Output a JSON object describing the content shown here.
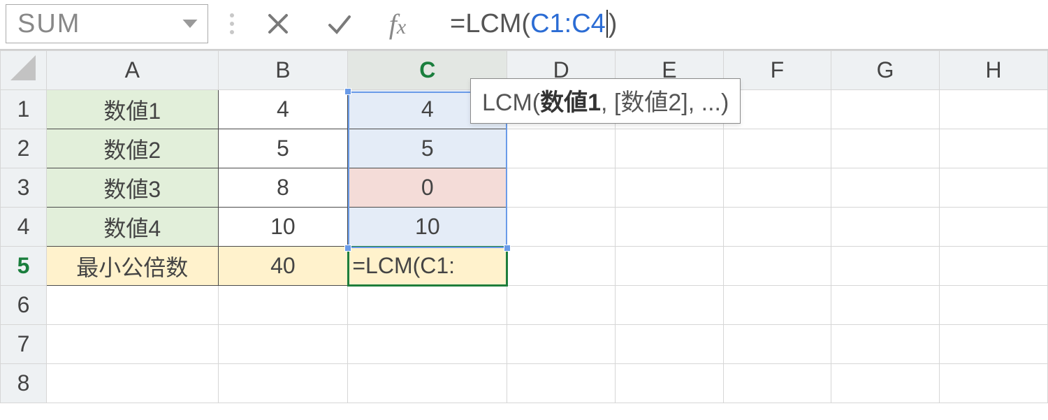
{
  "formula_bar": {
    "name_box": "SUM",
    "formula_prefix": "=LCM(",
    "formula_ref": "C1:C4",
    "formula_suffix": ")"
  },
  "tooltip": {
    "fn": "LCM(",
    "arg1": "数値1",
    "rest": ", [数値2], ...)"
  },
  "columns": [
    "A",
    "B",
    "C",
    "D",
    "E",
    "F",
    "G",
    "H"
  ],
  "row_headers": [
    "1",
    "2",
    "3",
    "4",
    "5",
    "6",
    "7",
    "8"
  ],
  "rows": [
    {
      "a": "数値1",
      "b": "4",
      "c": "4"
    },
    {
      "a": "数値2",
      "b": "5",
      "c": "5"
    },
    {
      "a": "数値3",
      "b": "8",
      "c": "0"
    },
    {
      "a": "数値4",
      "b": "10",
      "c": "10"
    },
    {
      "a": "最小公倍数",
      "b": "40",
      "c": "=LCM(C1:"
    }
  ],
  "active": {
    "col": "C",
    "row": "5"
  },
  "chart_data": {
    "type": "table",
    "title": "",
    "columns": [
      "A",
      "B",
      "C"
    ],
    "rows": [
      [
        "数値1",
        4,
        4
      ],
      [
        "数値2",
        5,
        5
      ],
      [
        "数値3",
        8,
        0
      ],
      [
        "数値4",
        10,
        10
      ],
      [
        "最小公倍数",
        40,
        "=LCM(C1:C4)"
      ]
    ]
  }
}
